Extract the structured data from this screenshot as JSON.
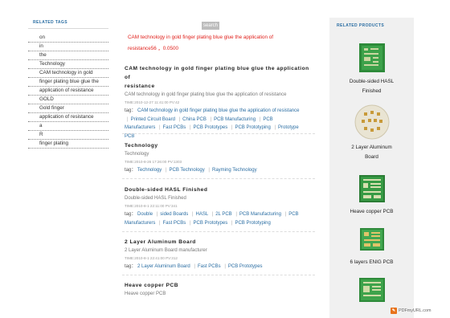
{
  "related_tags": {
    "title": "RELATED TAGS",
    "items": [
      "on",
      "in",
      "the",
      "Technology",
      "CAM technology in gold",
      "finger plating blue glue the",
      "application of resistance",
      "GOLD",
      "Gold finger",
      "application of resistance",
      "a",
      "R",
      "finger plating"
    ]
  },
  "search": {
    "label": "search"
  },
  "highlight": {
    "line1": "CAM technology in gold finger plating blue glue the application of",
    "line2": "resistance56 ，0.0500"
  },
  "articles": [
    {
      "title_lines": [
        "CAM technology in gold finger plating blue glue the application of",
        "resistance"
      ],
      "subtitle": "CAM technology in gold finger plating blue glue the application of resistance",
      "meta": "TIME:2010-12-27 11:41:00    PV:42",
      "tags_label": "tag：",
      "tag_lines": [
        [
          "CAM technology in gold finger plating blue glue the application of resistance"
        ],
        [
          "Printed Circuit Board",
          "China PCB",
          "PCB Manufacturing",
          "PCB"
        ],
        [
          "Manufacturers",
          "Fast PCBs",
          "PCB Prototypes",
          "PCB Prototyping",
          "Prototype"
        ],
        [
          "PCB"
        ]
      ]
    },
    {
      "title_lines": [
        "Technology"
      ],
      "subtitle": "Technology",
      "meta": "TIME:2010-8-26 17:26:00    PV:1303",
      "tags_label": "tag：",
      "tag_lines": [
        [
          "Technology",
          "PCB Technology",
          "Rayming Technology"
        ]
      ]
    },
    {
      "title_lines": [
        "Double-sided HASL Finished"
      ],
      "subtitle": "Double-sided HASL Finished",
      "meta": "TIME:2010-8-1 22:11:00    PV:341",
      "tags_label": "tag：",
      "tag_lines": [
        [
          "Double",
          "sided Boards",
          "HASL",
          "2L PCB",
          "PCB Manufacturing",
          "PCB"
        ],
        [
          "Manufacturers",
          "Fast PCBs",
          "PCB Prototypes",
          "PCB Prototyping"
        ]
      ]
    },
    {
      "title_lines": [
        "2 Layer Aluminum Board"
      ],
      "subtitle": "2 Layer Aluminum Board manufacturer",
      "meta": "TIME:2010-8-1 22:41:00    PV:312",
      "tags_label": "tag：",
      "tag_lines": [
        [
          "2 Layer Aluminum Board",
          "Fast PCBs",
          "PCB Prototypes"
        ]
      ]
    },
    {
      "title_lines": [
        "Heave copper PCB"
      ],
      "subtitle": "Heave copper PCB",
      "meta": "",
      "tags_label": "",
      "tag_lines": []
    }
  ],
  "related_products": {
    "title": "RELATED PRODUCTS",
    "items": [
      {
        "caption_lines": [
          "Double-sided HASL",
          "Finished"
        ],
        "image": "green-pcb-board"
      },
      {
        "caption_lines": [
          "2 Layer Aluminum",
          "Board"
        ],
        "image": "round-aluminum-pcb"
      },
      {
        "caption_lines": [
          "Heave copper PCB"
        ],
        "image": "green-pcb-board"
      },
      {
        "caption_lines": [
          "6 layers ENIG PCB"
        ],
        "image": "green-pcb-board"
      },
      {
        "caption_lines": [],
        "image": "green-pcb-board"
      }
    ]
  },
  "footer": {
    "badge_text": "PDFmyURL.com",
    "icon": "pdf-icon"
  },
  "colors": {
    "link": "#2b6ea3",
    "highlight": "#e0201b",
    "sidebar_bg": "#f0f0f0",
    "pcb_green": "#2e8b3a"
  }
}
